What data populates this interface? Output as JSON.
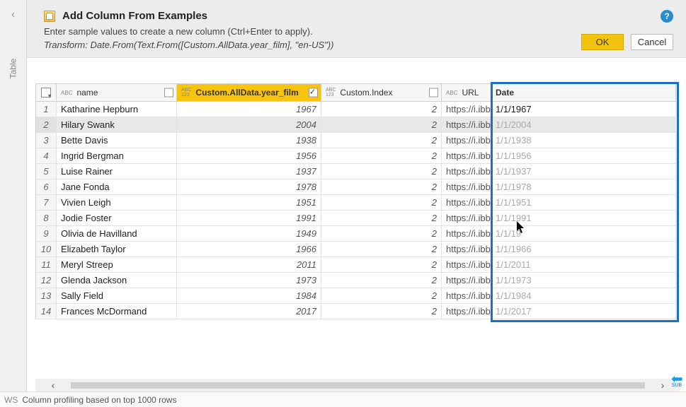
{
  "side": {
    "table_label": "Table"
  },
  "header": {
    "title": "Add Column From Examples",
    "subtitle": "Enter sample values to create a new column (Ctrl+Enter to apply).",
    "formula": "Transform: Date.From(Text.From([Custom.AllData.year_film], \"en-US\"))",
    "ok_label": "OK",
    "cancel_label": "Cancel"
  },
  "columns": {
    "name": "name",
    "year": "Custom.AllData.year_film",
    "custom": "Custom.Index",
    "url": "URL",
    "date": "Date"
  },
  "rows": [
    {
      "i": "1",
      "name": "Katharine Hepburn",
      "year": "1967",
      "custom": "2",
      "url": "https://i.ibb",
      "date": "1/1/1967",
      "entered": true
    },
    {
      "i": "2",
      "name": "Hilary Swank",
      "year": "2004",
      "custom": "2",
      "url": "https://i.ibb",
      "date": "1/1/2004",
      "entered": false,
      "selected": true
    },
    {
      "i": "3",
      "name": "Bette Davis",
      "year": "1938",
      "custom": "2",
      "url": "https://i.ibb",
      "date": "1/1/1938",
      "entered": false
    },
    {
      "i": "4",
      "name": "Ingrid Bergman",
      "year": "1956",
      "custom": "2",
      "url": "https://i.ibb",
      "date": "1/1/1956",
      "entered": false
    },
    {
      "i": "5",
      "name": "Luise Rainer",
      "year": "1937",
      "custom": "2",
      "url": "https://i.ibb",
      "date": "1/1/1937",
      "entered": false
    },
    {
      "i": "6",
      "name": "Jane Fonda",
      "year": "1978",
      "custom": "2",
      "url": "https://i.ibb",
      "date": "1/1/1978",
      "entered": false
    },
    {
      "i": "7",
      "name": "Vivien Leigh",
      "year": "1951",
      "custom": "2",
      "url": "https://i.ibb",
      "date": "1/1/1951",
      "entered": false
    },
    {
      "i": "8",
      "name": "Jodie Foster",
      "year": "1991",
      "custom": "2",
      "url": "https://i.ibb",
      "date": "1/1/1991",
      "entered": false
    },
    {
      "i": "9",
      "name": "Olivia de Havilland",
      "year": "1949",
      "custom": "2",
      "url": "https://i.ibb",
      "date": "1/1/19",
      "entered": false
    },
    {
      "i": "10",
      "name": "Elizabeth Taylor",
      "year": "1966",
      "custom": "2",
      "url": "https://i.ibb",
      "date": "1/1/1966",
      "entered": false
    },
    {
      "i": "11",
      "name": "Meryl Streep",
      "year": "2011",
      "custom": "2",
      "url": "https://i.ibb",
      "date": "1/1/2011",
      "entered": false
    },
    {
      "i": "12",
      "name": "Glenda Jackson",
      "year": "1973",
      "custom": "2",
      "url": "https://i.ibb",
      "date": "1/1/1973",
      "entered": false
    },
    {
      "i": "13",
      "name": "Sally Field",
      "year": "1984",
      "custom": "2",
      "url": "https://i.ibb",
      "date": "1/1/1984",
      "entered": false
    },
    {
      "i": "14",
      "name": "Frances McDormand",
      "year": "2017",
      "custom": "2",
      "url": "https://i.ibb",
      "date": "1/1/2017",
      "entered": false
    }
  ],
  "status": {
    "prefix": "WS",
    "text": "Column profiling based on top 1000 rows"
  },
  "sub_label": "SUB"
}
